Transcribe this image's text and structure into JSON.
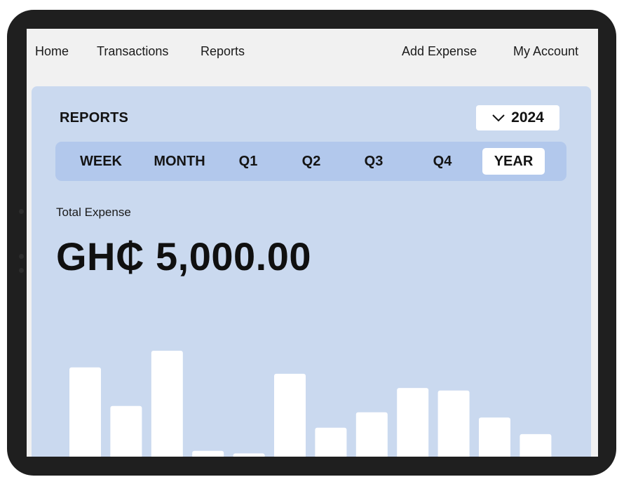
{
  "nav": {
    "home": "Home",
    "transactions": "Transactions",
    "reports": "Reports",
    "add_expense": "Add Expense",
    "my_account": "My Account"
  },
  "reports": {
    "title": "REPORTS",
    "year_selected": "2024",
    "dropdown_icon": "chevron-down-icon",
    "periods": [
      "WEEK",
      "MONTH",
      "Q1",
      "Q2",
      "Q3",
      "Q4",
      "YEAR"
    ],
    "active_period": "YEAR",
    "total_label": "Total Expense",
    "total_value": "GH₵ 5,000.00"
  },
  "colors": {
    "panel_bg": "#cad9ef",
    "tab_bar_bg": "#b2c8ec",
    "bar_fill": "#ffffff",
    "device_frame": "#1f1f1f"
  },
  "chart_data": {
    "type": "bar",
    "title": "",
    "xlabel": "",
    "ylabel": "",
    "categories": [],
    "values": [
      0.87,
      0.57,
      1.0,
      0.22,
      0.2,
      0.82,
      0.4,
      0.52,
      0.71,
      0.69,
      0.48,
      0.35
    ],
    "ylim": [
      0,
      1
    ],
    "grid": false,
    "note_units": "relative heights; axis not labeled"
  }
}
